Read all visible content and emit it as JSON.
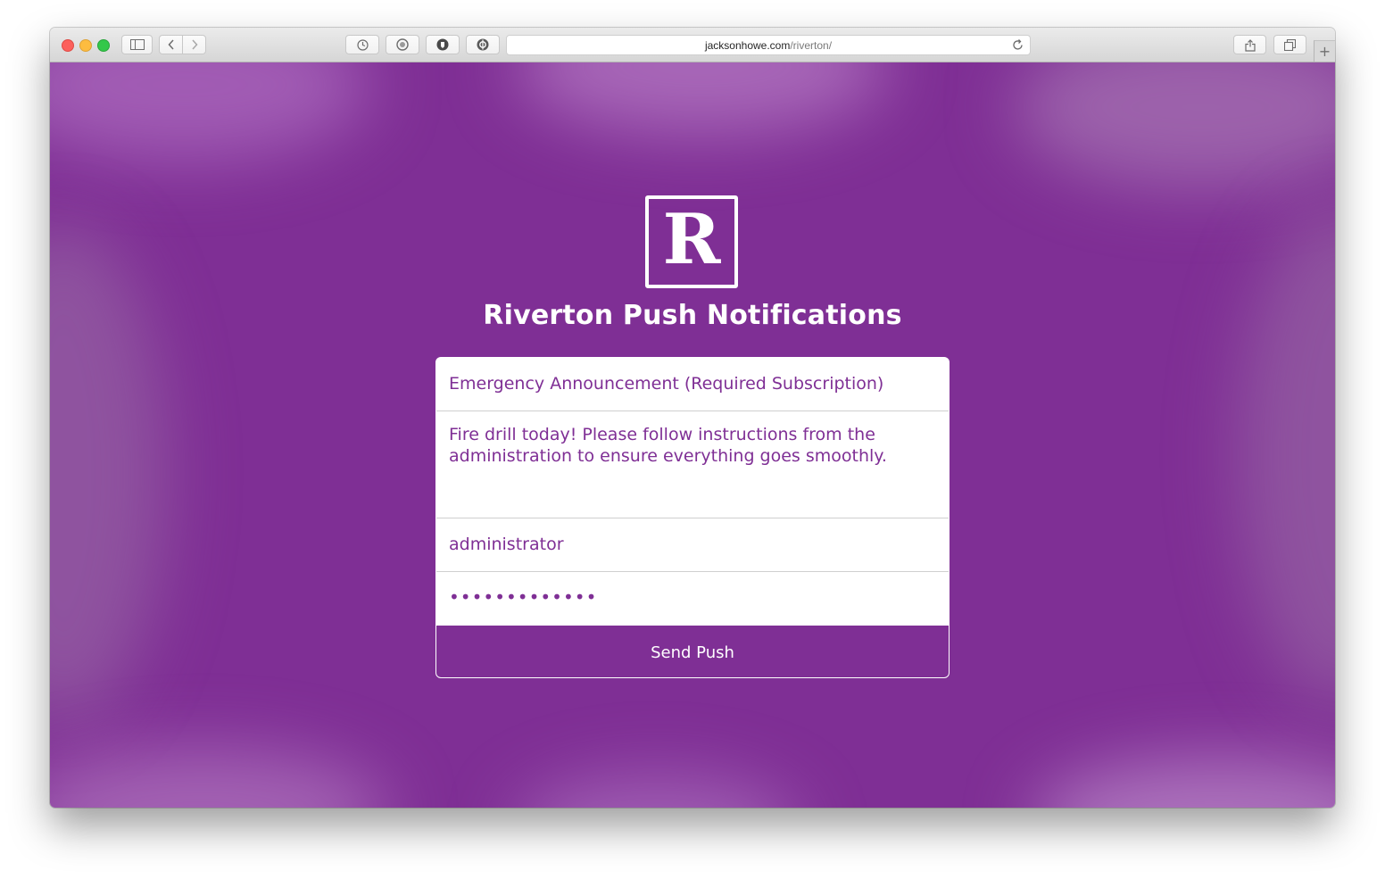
{
  "browser": {
    "url_domain": "jacksonhowe.com",
    "url_path": "/riverton/",
    "icons": [
      "sidebar-icon",
      "back-icon",
      "forward-icon",
      "history-icon",
      "reader-icon",
      "privacy-icon",
      "extensions-icon",
      "reload-icon",
      "share-icon",
      "tabs-icon",
      "new-tab-icon"
    ]
  },
  "page": {
    "logo_letter": "R",
    "title": "Riverton Push Notifications",
    "subject_value": "Emergency Announcement (Required Subscription)",
    "message_value": "Fire drill today! Please follow instructions from the administration to ensure everything goes smoothly.",
    "username_value": "administrator",
    "password_value": "•••••••••••••",
    "send_label": "Send Push"
  },
  "colors": {
    "brand_purple": "#7f2f95",
    "text_on_brand": "#ffffff"
  }
}
